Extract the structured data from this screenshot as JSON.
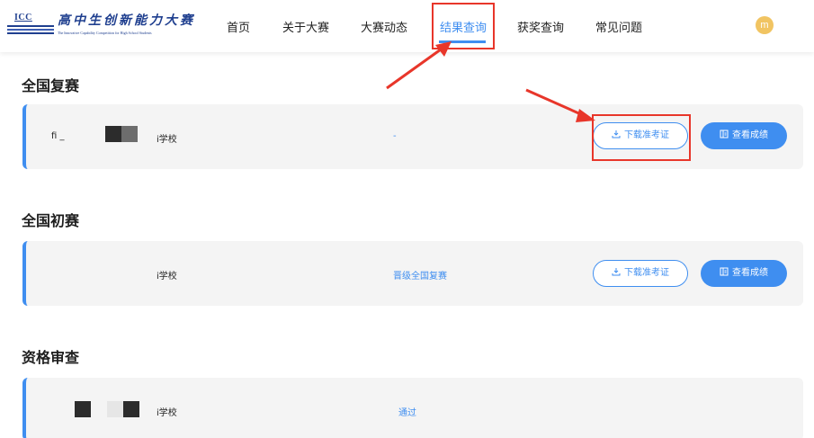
{
  "header": {
    "logo": {
      "abbr": "ICC",
      "title": "高中生创新能力大赛",
      "subtitle": "The Innovative Capability Competition for High School Students"
    },
    "nav": [
      {
        "label": "首页"
      },
      {
        "label": "关于大赛"
      },
      {
        "label": "大赛动态"
      },
      {
        "label": "结果查询",
        "active": true
      },
      {
        "label": "获奖查询"
      },
      {
        "label": "常见问题"
      }
    ],
    "avatar_initial": "m"
  },
  "sections": [
    {
      "title": "全国复赛",
      "name_fragment": "fi _",
      "school": "i学校",
      "status": "-",
      "download_label": "下载准考证",
      "score_label": "查看成绩"
    },
    {
      "title": "全国初赛",
      "school": "i学校",
      "status": "晋级全国复赛",
      "download_label": "下载准考证",
      "score_label": "查看成绩"
    },
    {
      "title": "资格审查",
      "school": "i学校",
      "status": "通过"
    }
  ],
  "colors": {
    "accent": "#3f8ef0",
    "annotation": "#e8362a",
    "card_bg": "#f4f4f4"
  },
  "icons": [
    "download-icon",
    "score-report-icon",
    "annotation-arrow-icon"
  ]
}
